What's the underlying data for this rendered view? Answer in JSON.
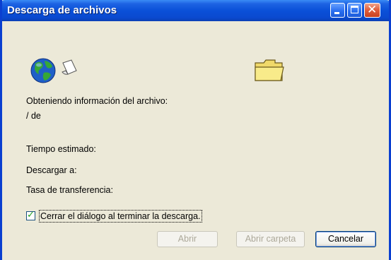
{
  "window": {
    "title": "Descarga de archivos"
  },
  "icons": {
    "globe": "globe-with-document-icon",
    "folder": "folder-icon",
    "minimize": "minimize-icon",
    "maximize": "maximize-icon",
    "close": "close-icon"
  },
  "status": {
    "obtaining_label": "Obteniendo información del archivo:",
    "progress_text": "/ de",
    "estimated_time_label": "Tiempo estimado:",
    "download_to_label": "Descargar a:",
    "transfer_rate_label": "Tasa de transferencia:"
  },
  "options": {
    "close_on_complete_label": "Cerrar el diálogo al terminar la descarga.",
    "close_on_complete_checked": true
  },
  "buttons": {
    "open": "Abrir",
    "open_folder": "Abrir carpeta",
    "cancel": "Cancelar"
  },
  "colors": {
    "titlebar": "#0a50d8",
    "dialog_bg": "#ece9d8",
    "close_button": "#e2603f"
  }
}
